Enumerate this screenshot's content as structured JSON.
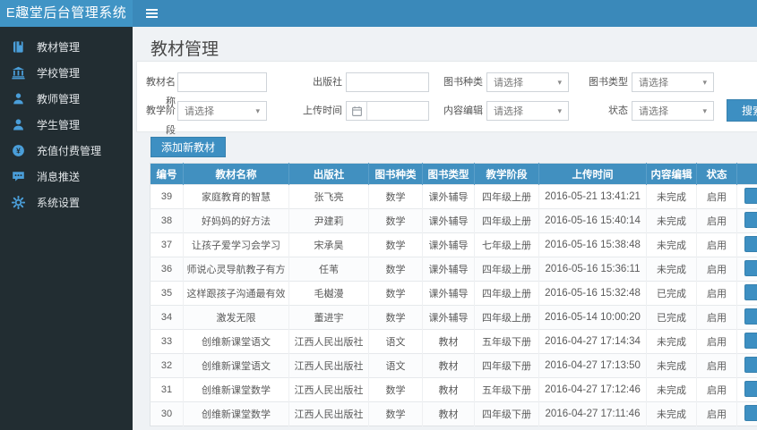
{
  "header": {
    "logo": "E趣堂后台管理系统",
    "menu_toggle_icon": "hamburger-icon"
  },
  "sidebar": {
    "items": [
      {
        "name": "textbook-management",
        "icon": "book",
        "label": "教材管理"
      },
      {
        "name": "school-management",
        "icon": "bank",
        "label": "学校管理"
      },
      {
        "name": "teacher-management",
        "icon": "teacher",
        "label": "教师管理"
      },
      {
        "name": "student-management",
        "icon": "student",
        "label": "学生管理"
      },
      {
        "name": "payment-management",
        "icon": "coin",
        "label": "充值付费管理"
      },
      {
        "name": "message-push",
        "icon": "message",
        "label": "消息推送"
      },
      {
        "name": "system-settings",
        "icon": "gear",
        "label": "系统设置"
      }
    ]
  },
  "page": {
    "title": "教材管理"
  },
  "filters": {
    "search_label": "搜索",
    "fields_row1": [
      {
        "name": "textbook-name",
        "label": "教材名称",
        "type": "text",
        "value": ""
      },
      {
        "name": "publisher",
        "label": "出版社",
        "type": "text",
        "value": ""
      },
      {
        "name": "book-category",
        "label": "图书种类",
        "type": "select",
        "value": "请选择"
      },
      {
        "name": "book-type",
        "label": "图书类型",
        "type": "select",
        "value": "请选择"
      }
    ],
    "fields_row2": [
      {
        "name": "teaching-stage",
        "label": "教学阶段",
        "type": "select",
        "value": "请选择"
      },
      {
        "name": "upload-time",
        "label": "上传时间",
        "type": "date",
        "value": ""
      },
      {
        "name": "content-editor",
        "label": "内容编辑",
        "type": "select",
        "value": "请选择"
      },
      {
        "name": "status",
        "label": "状态",
        "type": "select",
        "value": "请选择"
      }
    ]
  },
  "actions": {
    "add_label": "添加新教材"
  },
  "table": {
    "columns": [
      "编号",
      "教材名称",
      "出版社",
      "图书种类",
      "图书类型",
      "教学阶段",
      "上传时间",
      "内容编辑",
      "状态",
      ""
    ],
    "rows": [
      [
        "39",
        "家庭教育的智慧",
        "张飞亮",
        "数学",
        "课外辅导",
        "四年级上册",
        "2016-05-21 13:41:21",
        "未完成",
        "启用"
      ],
      [
        "38",
        "好妈妈的好方法",
        "尹建莉",
        "数学",
        "课外辅导",
        "四年级上册",
        "2016-05-16 15:40:14",
        "未完成",
        "启用"
      ],
      [
        "37",
        "让孩子爱学习会学习",
        "宋承昊",
        "数学",
        "课外辅导",
        "七年级上册",
        "2016-05-16 15:38:48",
        "未完成",
        "启用"
      ],
      [
        "36",
        "师说心灵导航教子有方",
        "任苇",
        "数学",
        "课外辅导",
        "四年级上册",
        "2016-05-16 15:36:11",
        "未完成",
        "启用"
      ],
      [
        "35",
        "这样跟孩子沟通最有效",
        "毛樾漫",
        "数学",
        "课外辅导",
        "四年级上册",
        "2016-05-16 15:32:48",
        "已完成",
        "启用"
      ],
      [
        "34",
        "激发无限",
        "董进宇",
        "数学",
        "课外辅导",
        "四年级上册",
        "2016-05-14 10:00:20",
        "已完成",
        "启用"
      ],
      [
        "33",
        "创维新课堂语文",
        "江西人民出版社",
        "语文",
        "教材",
        "五年级下册",
        "2016-04-27 17:14:34",
        "未完成",
        "启用"
      ],
      [
        "32",
        "创维新课堂语文",
        "江西人民出版社",
        "语文",
        "教材",
        "四年级下册",
        "2016-04-27 17:13:50",
        "未完成",
        "启用"
      ],
      [
        "31",
        "创维新课堂数学",
        "江西人民出版社",
        "数学",
        "教材",
        "五年级下册",
        "2016-04-27 17:12:46",
        "未完成",
        "启用"
      ],
      [
        "30",
        "创维新课堂数学",
        "江西人民出版社",
        "数学",
        "教材",
        "四年级下册",
        "2016-04-27 17:11:46",
        "未完成",
        "启用"
      ]
    ]
  },
  "colors": {
    "logo_bg": "#4094c5",
    "navbar_bg": "#3a89ba",
    "sidebar_bg": "#222d32",
    "sidebar_icon": "#4a9ed9",
    "accent_blue": "#3d8fc2",
    "table_header_bg": "#4190c0",
    "content_bg": "#eff2f5"
  }
}
